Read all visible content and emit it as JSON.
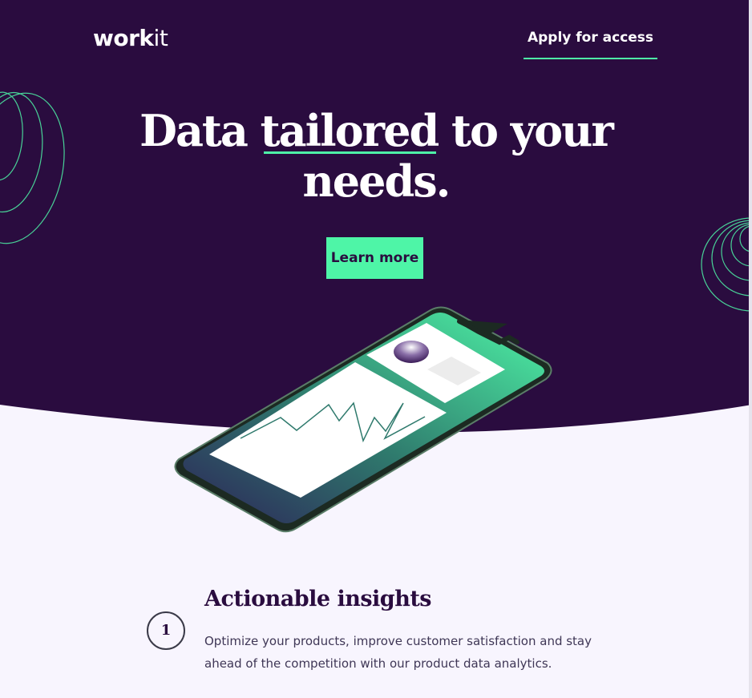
{
  "header": {
    "logo_bold": "work",
    "logo_light": "it",
    "apply_label": "Apply for access"
  },
  "hero": {
    "headline_part1": "Data ",
    "headline_highlight": "tailored",
    "headline_part2": " to your",
    "headline_line2": "needs.",
    "cta_label": "Learn more"
  },
  "features": [
    {
      "number": "1",
      "title": "Actionable insights",
      "description": "Optimize your products, improve customer satisfaction and stay ahead of the competition with our product data analytics."
    }
  ],
  "colors": {
    "dark_purple": "#2a0c3f",
    "mint": "#4ef5a7",
    "page_bg": "#f8f5fe"
  },
  "icons": [
    "decorative-loop-left-icon",
    "decorative-loop-right-icon",
    "phone-illustration"
  ]
}
